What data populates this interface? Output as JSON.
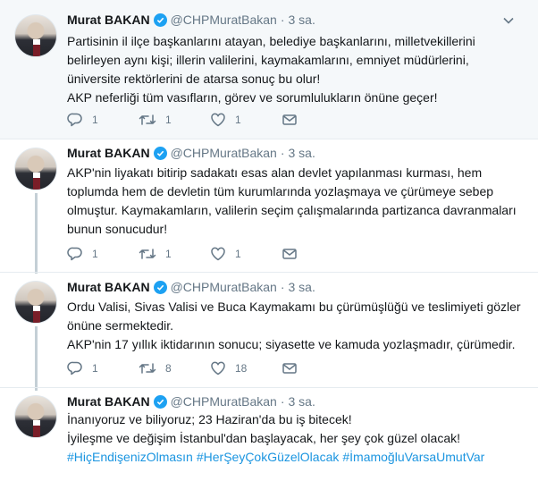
{
  "tweets": [
    {
      "name": "Murat BAKAN",
      "handle": "@CHPMuratBakan",
      "separator": "·",
      "time": "3 sa.",
      "lines": [
        "Partisinin il ilçe başkanlarını atayan, belediye başkanlarını, milletvekillerini",
        "belirleyen aynı kişi; illerin valilerini, kaymakamlarını, emniyet müdürlerini,",
        "üniversite rektörlerini de atarsa sonuç bu olur!",
        "AKP neferliği tüm vasıfların, görev ve sorumlulukların önüne geçer!"
      ],
      "reply_count": "1",
      "retweet_count": "1",
      "like_count": "1"
    },
    {
      "name": "Murat BAKAN",
      "handle": "@CHPMuratBakan",
      "separator": "·",
      "time": "3 sa.",
      "lines": [
        "AKP'nin liyakatı bitirip sadakatı esas alan devlet yapılanması kurması, hem",
        "toplumda hem de devletin tüm kurumlarında yozlaşmaya ve çürümeye sebep",
        "olmuştur. Kaymakamların, valilerin seçim çalışmalarında partizanca davranmaları",
        "bunun sonucudur!"
      ],
      "reply_count": "1",
      "retweet_count": "1",
      "like_count": "1"
    },
    {
      "name": "Murat BAKAN",
      "handle": "@CHPMuratBakan",
      "separator": "·",
      "time": "3 sa.",
      "lines": [
        "Ordu Valisi, Sivas Valisi ve Buca Kaymakamı bu çürümüşlüğü ve teslimiyeti gözler",
        "önüne sermektedir.",
        "AKP'nin 17 yıllık iktidarının sonucu; siyasette ve kamuda yozlaşmadır, çürümedir."
      ],
      "reply_count": "1",
      "retweet_count": "8",
      "like_count": "18"
    },
    {
      "name": "Murat BAKAN",
      "handle": "@CHPMuratBakan",
      "separator": "·",
      "time": "3 sa.",
      "lines": [
        "İnanıyoruz ve biliyoruz; 23 Haziran'da bu iş bitecek!",
        "İyileşme ve değişim İstanbul'dan başlayacak, her şey çok güzel olacak!"
      ],
      "hashtags": [
        "#HiçEndişenizOlmasın",
        "#HerŞeyÇokGüzelOlacak",
        "#İmamoğluVarsaUmutVar"
      ]
    }
  ],
  "colors": {
    "accent": "#1da1f2",
    "hashtag": "#1b95e0",
    "muted": "#657786",
    "thread_line": "#c4cfd6"
  },
  "icons": {
    "reply": "reply-icon",
    "retweet": "retweet-icon",
    "like": "heart-icon",
    "dm": "envelope-icon",
    "menu": "chevron-down-icon",
    "verified": "verified-badge-icon"
  }
}
